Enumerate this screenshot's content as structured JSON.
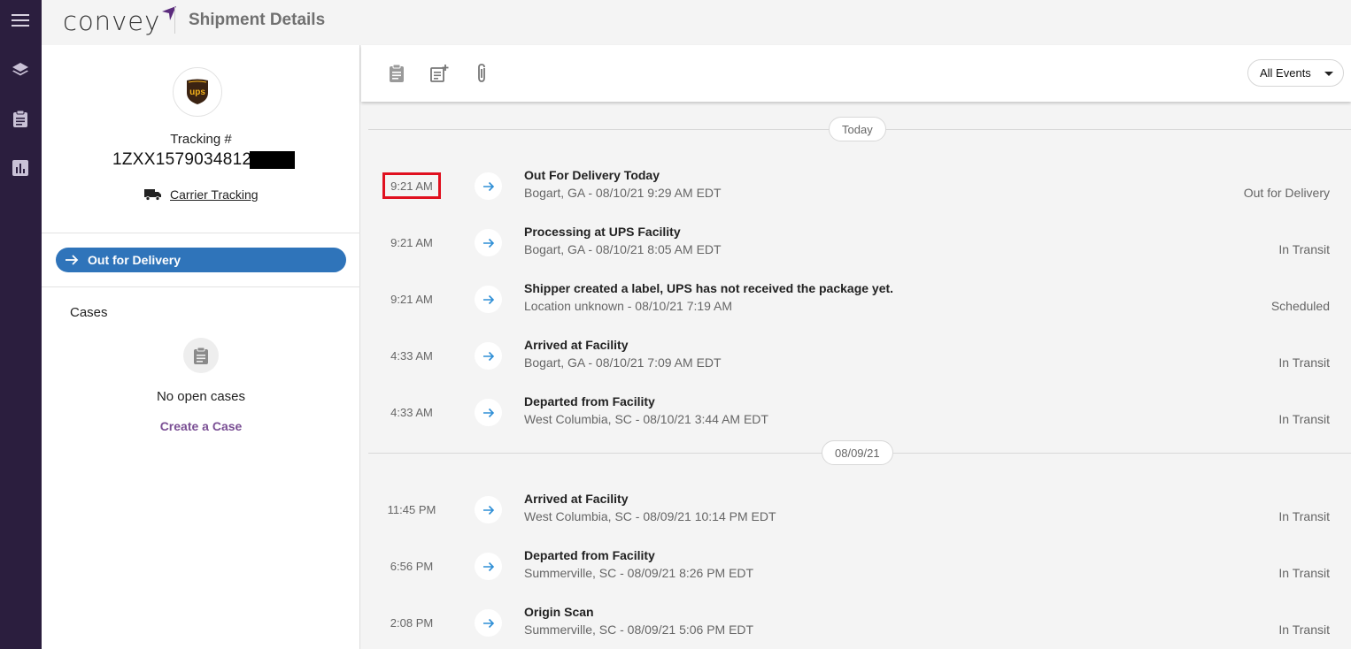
{
  "app": {
    "logo_text": "convey",
    "page_title": "Shipment Details"
  },
  "rail": {
    "items": [
      "menu-icon",
      "layers-icon",
      "clipboard-icon",
      "chart-icon"
    ]
  },
  "shipment": {
    "tracking_label": "Tracking #",
    "tracking_number": "1ZXX1579034812",
    "carrier_tracking_label": "Carrier Tracking",
    "carrier_logo_text": "ups",
    "status_label": "Out for Delivery"
  },
  "cases": {
    "title": "Cases",
    "empty_text": "No open cases",
    "create_label": "Create a Case"
  },
  "toolbar": {
    "filter_value": "All Events"
  },
  "timeline": {
    "groups": [
      {
        "date_label": "Today"
      },
      {
        "date_label": "08/09/21"
      }
    ],
    "events": [
      {
        "time": "9:21 AM",
        "title": "Out For Delivery Today",
        "location": "Bogart, GA - 08/10/21 9:29 AM EDT",
        "status": "Out for Delivery"
      },
      {
        "time": "9:21 AM",
        "title": "Processing at UPS Facility",
        "location": "Bogart, GA - 08/10/21 8:05 AM EDT",
        "status": "In Transit"
      },
      {
        "time": "9:21 AM",
        "title": "Shipper created a label, UPS has not received the package yet.",
        "location": "Location unknown - 08/10/21 7:19 AM",
        "status": "Scheduled"
      },
      {
        "time": "4:33 AM",
        "title": "Arrived at Facility",
        "location": "Bogart, GA - 08/10/21 7:09 AM EDT",
        "status": "In Transit"
      },
      {
        "time": "4:33 AM",
        "title": "Departed from Facility",
        "location": "West Columbia, SC - 08/10/21 3:44 AM EDT",
        "status": "In Transit"
      },
      {
        "time": "11:45 PM",
        "title": "Arrived at Facility",
        "location": "West Columbia, SC - 08/09/21 10:14 PM EDT",
        "status": "In Transit"
      },
      {
        "time": "6:56 PM",
        "title": "Departed from Facility",
        "location": "Summerville, SC - 08/09/21 8:26 PM EDT",
        "status": "In Transit"
      },
      {
        "time": "2:08 PM",
        "title": "Origin Scan",
        "location": "Summerville, SC - 08/09/21 5:06 PM EDT",
        "status": "In Transit"
      }
    ]
  },
  "colors": {
    "rail": "#2b1e3e",
    "accent": "#2f74ba",
    "link": "#7a4f94",
    "highlight": "#e0101f"
  }
}
